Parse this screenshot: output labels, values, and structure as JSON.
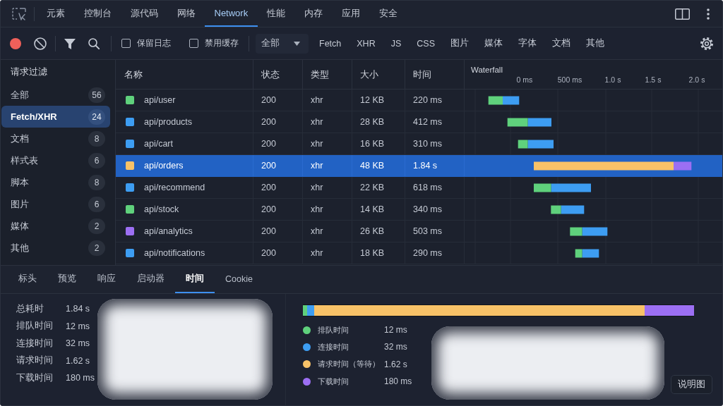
{
  "tab_bar": {
    "tabs": [
      {
        "label": "元素",
        "selected": false
      },
      {
        "label": "控制台",
        "selected": false
      },
      {
        "label": "源代码",
        "selected": false
      },
      {
        "label": "网络",
        "selected": false
      },
      {
        "label": "Network",
        "selected": true
      },
      {
        "label": "性能",
        "selected": false
      },
      {
        "label": "内存",
        "selected": false
      },
      {
        "label": "应用",
        "selected": false
      },
      {
        "label": "安全",
        "selected": false
      }
    ]
  },
  "toolbar": {
    "recording": true,
    "checkboxes": [
      {
        "label": "保留日志",
        "checked": false
      },
      {
        "label": "禁用缓存",
        "checked": false
      }
    ],
    "dropdown": {
      "value": "全部"
    },
    "type_filters": [
      "Fetch",
      "XHR",
      "JS",
      "CSS",
      "图片",
      "媒体",
      "字体",
      "文档",
      "其他"
    ]
  },
  "sidebar": {
    "title": "请求过滤",
    "items": [
      {
        "label": "全部",
        "count": "56",
        "selected": false
      },
      {
        "label": "Fetch/XHR",
        "count": "24",
        "selected": true
      },
      {
        "label": "文档",
        "count": "8",
        "selected": false
      },
      {
        "label": "样式表",
        "count": "6",
        "selected": false
      },
      {
        "label": "脚本",
        "count": "8",
        "selected": false
      },
      {
        "label": "图片",
        "count": "6",
        "selected": false
      },
      {
        "label": "媒体",
        "count": "2",
        "selected": false
      },
      {
        "label": "其他",
        "count": "2",
        "selected": false
      }
    ]
  },
  "table": {
    "columns": [
      "名称",
      "状态",
      "类型",
      "大小",
      "时间"
    ],
    "rows": [
      {
        "name": "api/user",
        "status": "200",
        "type": "xhr",
        "size": "12 KB",
        "time": "220 ms",
        "color": "#5fd17c",
        "selected": false
      },
      {
        "name": "api/products",
        "status": "200",
        "type": "xhr",
        "size": "28 KB",
        "time": "412 ms",
        "color": "#3d9df2",
        "selected": false
      },
      {
        "name": "api/cart",
        "status": "200",
        "type": "xhr",
        "size": "16 KB",
        "time": "310 ms",
        "color": "#3d9df2",
        "selected": false
      },
      {
        "name": "api/orders",
        "status": "200",
        "type": "xhr",
        "size": "48 KB",
        "time": "1.84 s",
        "color": "#f8c268",
        "selected": true
      },
      {
        "name": "api/recommend",
        "status": "200",
        "type": "xhr",
        "size": "22 KB",
        "time": "618 ms",
        "color": "#3d9df2",
        "selected": false
      },
      {
        "name": "api/stock",
        "status": "200",
        "type": "xhr",
        "size": "14 KB",
        "time": "340 ms",
        "color": "#5fd17c",
        "selected": false
      },
      {
        "name": "api/analytics",
        "status": "200",
        "type": "xhr",
        "size": "26 KB",
        "time": "503 ms",
        "color": "#9c6ff3",
        "selected": false
      },
      {
        "name": "api/notifications",
        "status": "200",
        "type": "xhr",
        "size": "18 KB",
        "time": "290 ms",
        "color": "#3d9df2",
        "selected": false
      }
    ],
    "waterfall": {
      "title": "Waterfall",
      "tick_labels": [
        "0 ms",
        "500 ms",
        "1.0 s",
        "1.5 s",
        "2.0 s"
      ]
    }
  },
  "details": {
    "tabs": [
      {
        "label": "标头",
        "selected": false
      },
      {
        "label": "预览",
        "selected": false
      },
      {
        "label": "响应",
        "selected": false
      },
      {
        "label": "启动器",
        "selected": false
      },
      {
        "label": "时间",
        "selected": true
      },
      {
        "label": "Cookie",
        "selected": false
      }
    ],
    "summary": [
      {
        "label": "总耗时",
        "value": "1.84 s"
      },
      {
        "label": "排队时间",
        "value": "12 ms"
      },
      {
        "label": "连接时间",
        "value": "32 ms"
      },
      {
        "label": "请求时间",
        "value": "1.62 s"
      },
      {
        "label": "下载时间",
        "value": "180 ms"
      }
    ],
    "timing_bar": {
      "segments": [
        {
          "color": "#5fd17c"
        },
        {
          "color": "#3d9df2"
        },
        {
          "color": "#f8c268"
        },
        {
          "color": "#9c6ff3"
        }
      ]
    },
    "legend": [
      {
        "label": "排队时间",
        "value": "12 ms",
        "color": "#5fd17c"
      },
      {
        "label": "连接时间",
        "value": "32 ms",
        "color": "#3d9df2"
      },
      {
        "label": "请求时间（等待）",
        "value": "1.62 s",
        "color": "#f8c268"
      },
      {
        "label": "下载时间",
        "value": "180 ms",
        "color": "#9c6ff3"
      }
    ],
    "button": "说明图"
  }
}
